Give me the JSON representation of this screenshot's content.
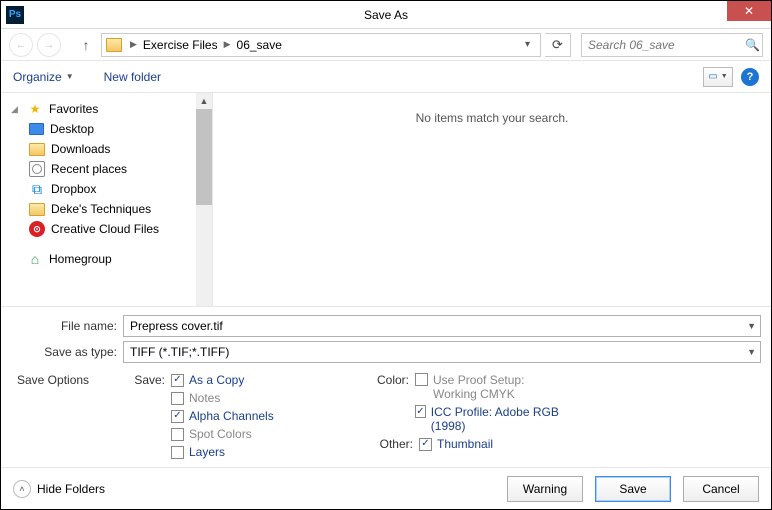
{
  "window": {
    "title": "Save As",
    "app_icon_text": "Ps"
  },
  "nav": {
    "breadcrumb": [
      "Exercise Files",
      "06_save"
    ],
    "search_placeholder": "Search 06_save"
  },
  "toolbar": {
    "organize": "Organize",
    "new_folder": "New folder"
  },
  "tree": {
    "favorites": {
      "label": "Favorites",
      "items": [
        {
          "icon": "desktop",
          "label": "Desktop"
        },
        {
          "icon": "folder",
          "label": "Downloads"
        },
        {
          "icon": "recent",
          "label": "Recent places"
        },
        {
          "icon": "dropbox",
          "label": "Dropbox"
        },
        {
          "icon": "folder",
          "label": "Deke's Techniques"
        },
        {
          "icon": "cc",
          "label": "Creative Cloud Files"
        }
      ]
    },
    "homegroup": {
      "label": "Homegroup"
    }
  },
  "content": {
    "empty_message": "No items match your search."
  },
  "form": {
    "file_name_label": "File name:",
    "file_name_value": "Prepress cover.tif",
    "save_type_label": "Save as type:",
    "save_type_value": "TIFF (*.TIF;*.TIFF)"
  },
  "save_options": {
    "header": "Save Options",
    "save_label": "Save:",
    "save_checks": [
      {
        "label": "As a Copy",
        "checked": true,
        "enabled": true
      },
      {
        "label": "Notes",
        "checked": false,
        "enabled": false
      },
      {
        "label": "Alpha Channels",
        "checked": true,
        "enabled": true
      },
      {
        "label": "Spot Colors",
        "checked": false,
        "enabled": false
      },
      {
        "label": "Layers",
        "checked": false,
        "enabled": true
      }
    ],
    "color_label": "Color:",
    "color_checks": [
      {
        "label": "Use Proof Setup:",
        "sublabel": "Working CMYK",
        "checked": false,
        "enabled": false
      },
      {
        "label": "ICC Profile:  Adobe RGB (1998)",
        "checked": true,
        "enabled": true
      }
    ],
    "other_label": "Other:",
    "other_checks": [
      {
        "label": "Thumbnail",
        "checked": true,
        "enabled": true
      }
    ]
  },
  "footer": {
    "hide_folders": "Hide Folders",
    "warning": "Warning",
    "save": "Save",
    "cancel": "Cancel"
  }
}
